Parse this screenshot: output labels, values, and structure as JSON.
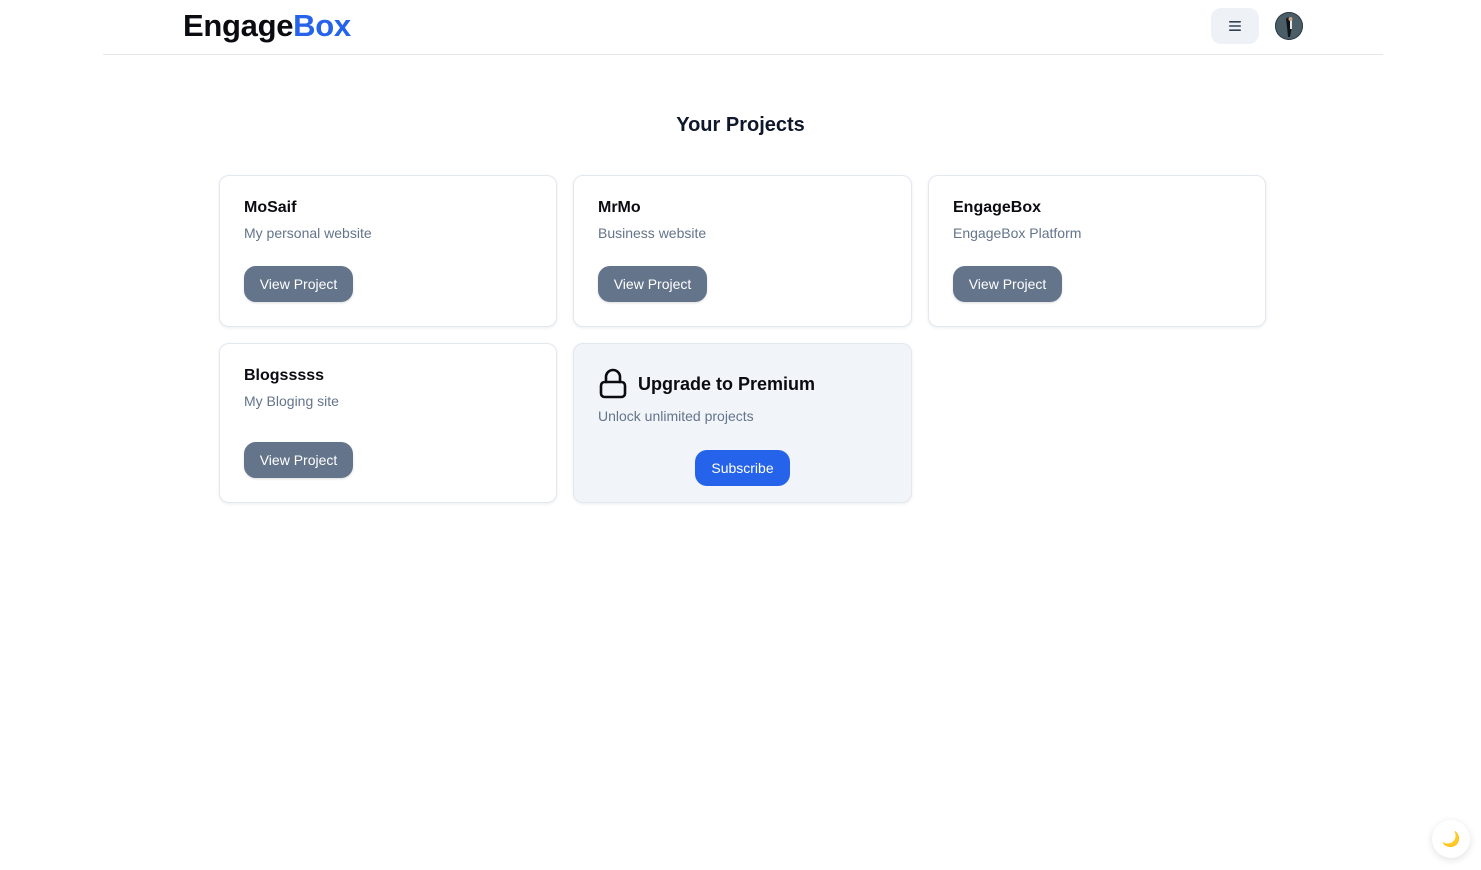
{
  "brand": {
    "part1": "Engage",
    "part2": "Box",
    "accent_color": "#2563eb"
  },
  "header": {
    "menu_icon": "menu-icon",
    "avatar": "avatar"
  },
  "page_title": "Your Projects",
  "projects": [
    {
      "name": "MoSaif",
      "description": "My personal website",
      "button": "View Project"
    },
    {
      "name": "MrMo",
      "description": "Business website",
      "button": "View Project"
    },
    {
      "name": "EngageBox",
      "description": "EngageBox Platform",
      "button": "View Project"
    },
    {
      "name": "Blogsssss",
      "description": "My Bloging site",
      "button": "View Project"
    }
  ],
  "premium": {
    "icon": "lock-icon",
    "title": "Upgrade to Premium",
    "description": "Unlock unlimited projects",
    "button": "Subscribe"
  },
  "theme_toggle": {
    "icon": "moon-icon",
    "glyph": "🌙"
  },
  "colors": {
    "button_gray": "#64748b",
    "button_blue": "#2563eb",
    "muted_text": "#64748b"
  }
}
